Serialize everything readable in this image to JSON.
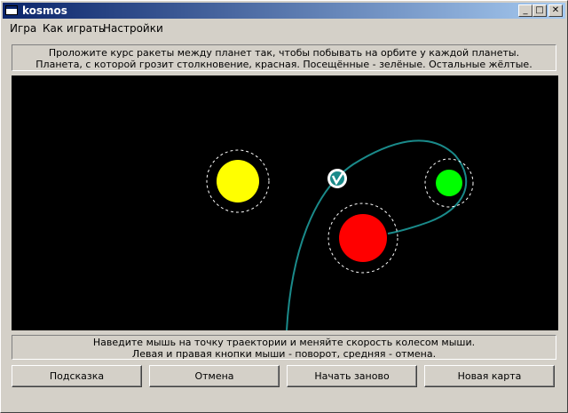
{
  "window": {
    "title": "kosmos"
  },
  "title_buttons": {
    "minimize": "_",
    "maximize": "□",
    "close": "✕"
  },
  "menu": [
    {
      "label": "Игра"
    },
    {
      "label": "Как играть"
    },
    {
      "label": "Настройки"
    }
  ],
  "instructions": {
    "line1": "Проложите курс ракеты между планет так, чтобы побывать на орбите у каждой планеты.",
    "line2": "Планета, с которой грозит столкновение, красная. Посещённые - зелёные. Остальные жёлтые."
  },
  "hint": {
    "line1": "Наведите мышь на точку траектории и меняйте скорость колесом мыши.",
    "line2": "Левая и правая кнопки мыши - поворот, средняя - отмена."
  },
  "buttons": [
    {
      "label": "Подсказка"
    },
    {
      "label": "Отмена"
    },
    {
      "label": "Начать заново"
    },
    {
      "label": "Новая карта"
    }
  ],
  "colors": {
    "planet_unvisited": "#ffff00",
    "planet_danger": "#ff0000",
    "planet_visited": "#00ff00",
    "trajectory": "#1a8a8a",
    "orbit_ring": "#ffffff",
    "space": "#000000"
  },
  "planets": [
    {
      "state": "unvisited"
    },
    {
      "state": "danger"
    },
    {
      "state": "visited"
    }
  ]
}
